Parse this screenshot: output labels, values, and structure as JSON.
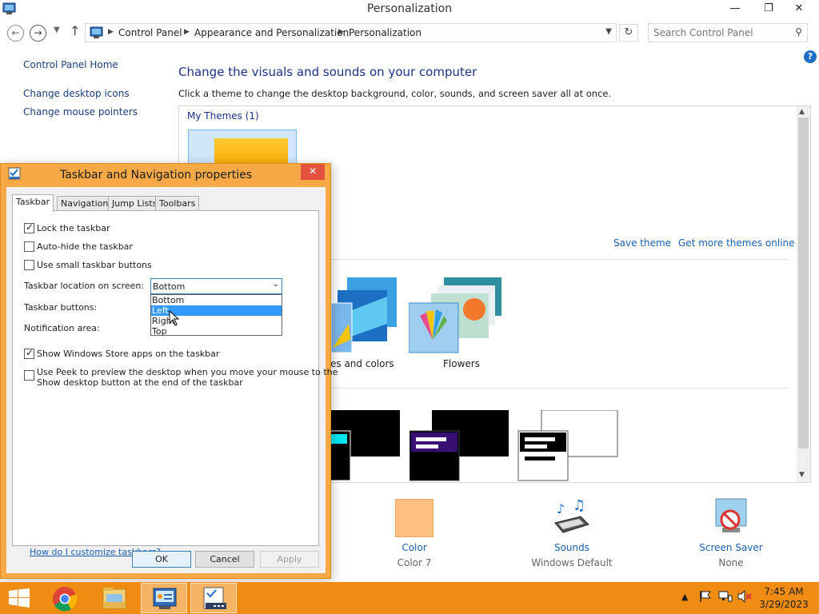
{
  "window": {
    "title": "Personalization",
    "minimize": "—",
    "restore": "❐",
    "close": "✕"
  },
  "address": {
    "breadcrumb": [
      "Control Panel",
      "Appearance and Personalization",
      "Personalization"
    ],
    "search_placeholder": "Search Control Panel"
  },
  "sidebar": {
    "items": [
      {
        "label": "Control Panel Home"
      },
      {
        "label": "Change desktop icons"
      },
      {
        "label": "Change mouse pointers"
      }
    ]
  },
  "main": {
    "heading": "Change the visuals and sounds on your computer",
    "subheading": "Click a theme to change the desktop background, color, sounds, and screen saver all at once.",
    "my_themes_title": "My Themes (1)",
    "save_theme": "Save theme",
    "get_more_themes": "Get more themes online",
    "themes": [
      {
        "label": "es and colors"
      },
      {
        "label": "Flowers"
      }
    ]
  },
  "bottom_settings": [
    {
      "label": "Color",
      "value": "Color 7",
      "icon": "color-swatch-icon",
      "color": "#ffc080"
    },
    {
      "label": "Sounds",
      "value": "Windows Default",
      "icon": "sounds-icon"
    },
    {
      "label": "Screen Saver",
      "value": "None",
      "icon": "screen-saver-icon"
    }
  ],
  "dialog": {
    "title": "Taskbar and Navigation properties",
    "tabs": [
      {
        "label": "Taskbar",
        "active": true
      },
      {
        "label": "Navigation",
        "active": false
      },
      {
        "label": "Jump Lists",
        "active": false
      },
      {
        "label": "Toolbars",
        "active": false
      }
    ],
    "checkboxes": [
      {
        "label": "Lock the taskbar",
        "checked": true
      },
      {
        "label": "Auto-hide the taskbar",
        "checked": false
      },
      {
        "label": "Use small taskbar buttons",
        "checked": false
      },
      {
        "label": "Show Windows Store apps on the taskbar",
        "checked": true
      },
      {
        "label": "Use Peek to preview the desktop when you move your mouse to the",
        "label2": "Show desktop button at the end of the taskbar",
        "checked": false
      }
    ],
    "location_label": "Taskbar location on screen:",
    "location_value": "Bottom",
    "location_options": [
      "Bottom",
      "Left",
      "Right",
      "Top"
    ],
    "location_highlighted": "Left",
    "buttons_label": "Taskbar buttons:",
    "notification_label": "Notification area:",
    "help_link": "How do I customize taskbars?",
    "ok": "OK",
    "cancel": "Cancel",
    "apply": "Apply"
  },
  "taskbar": {
    "time": "7:45 AM",
    "date": "3/29/2023",
    "accent": "#f08c12"
  }
}
